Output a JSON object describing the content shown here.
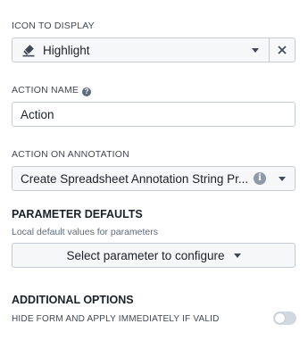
{
  "icon_section": {
    "label": "ICON TO DISPLAY",
    "value": "Highlight",
    "icon": "highlight-pen-icon"
  },
  "action_name": {
    "label": "ACTION NAME",
    "help": "?",
    "value": "Action"
  },
  "action_on_annotation": {
    "label": "ACTION ON ANNOTATION",
    "value": "Create Spreadsheet Annotation String Pr...",
    "info": "i"
  },
  "parameter_defaults": {
    "heading": "PARAMETER DEFAULTS",
    "description": "Local default values for parameters",
    "button_label": "Select parameter to configure"
  },
  "additional_options": {
    "heading": "ADDITIONAL OPTIONS",
    "toggle_label": "HIDE FORM AND APPLY IMMEDIATELY IF VALID",
    "toggle_on": false
  },
  "colors": {
    "border": "#c5cbd3",
    "text": "#1c2127",
    "muted": "#5f6b7c",
    "toggle_off": "#d3d8de"
  }
}
